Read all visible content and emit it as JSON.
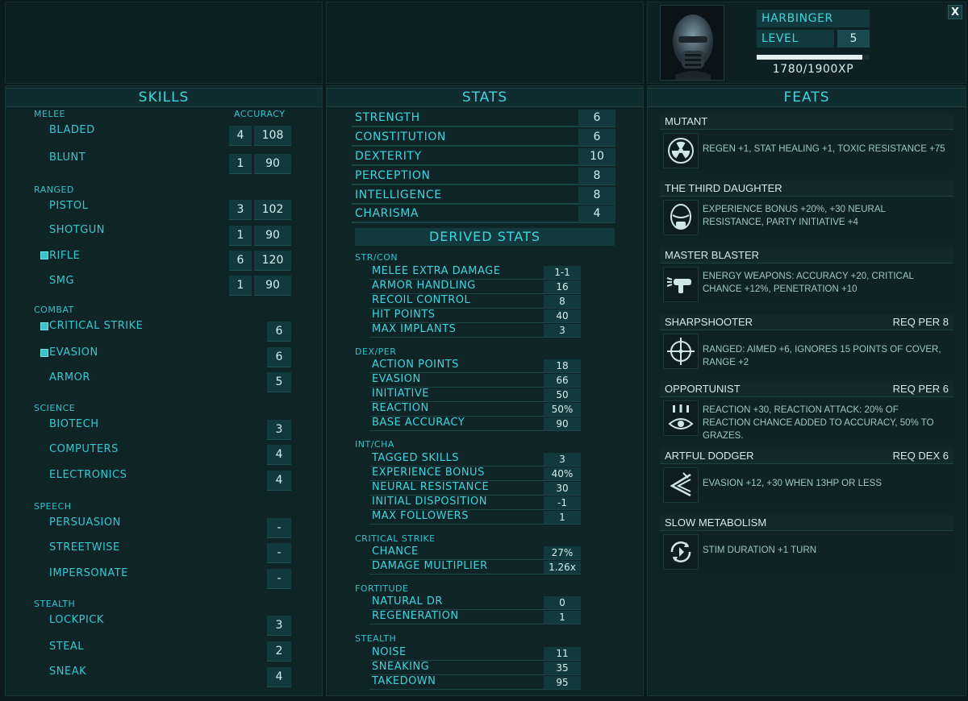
{
  "character": {
    "name": "HARBINGER",
    "level_label": "LEVEL",
    "level": "5",
    "xp_text": "1780/1900XP",
    "xp_progress": 0.937
  },
  "close_label": "X",
  "skills": {
    "title": "SKILLS",
    "accuracy_label": "ACCURACY",
    "categories": [
      {
        "name": "MELEE",
        "items": [
          {
            "name": "BLADED",
            "value": "4",
            "accuracy": "108",
            "tagged": false
          },
          {
            "name": "BLUNT",
            "value": "1",
            "accuracy": "90",
            "tagged": false
          }
        ]
      },
      {
        "name": "RANGED",
        "items": [
          {
            "name": "PISTOL",
            "value": "3",
            "accuracy": "102",
            "tagged": false
          },
          {
            "name": "SHOTGUN",
            "value": "1",
            "accuracy": "90",
            "tagged": false
          },
          {
            "name": "RIFLE",
            "value": "6",
            "accuracy": "120",
            "tagged": true
          },
          {
            "name": "SMG",
            "value": "1",
            "accuracy": "90",
            "tagged": false
          }
        ]
      },
      {
        "name": "COMBAT",
        "items": [
          {
            "name": "CRITICAL STRIKE",
            "value": "6",
            "tagged": true
          },
          {
            "name": "EVASION",
            "value": "6",
            "tagged": true
          },
          {
            "name": "ARMOR",
            "value": "5",
            "tagged": false
          }
        ]
      },
      {
        "name": "SCIENCE",
        "items": [
          {
            "name": "BIOTECH",
            "value": "3",
            "tagged": false
          },
          {
            "name": "COMPUTERS",
            "value": "4",
            "tagged": false
          },
          {
            "name": "ELECTRONICS",
            "value": "4",
            "tagged": false
          }
        ]
      },
      {
        "name": "SPEECH",
        "items": [
          {
            "name": "PERSUASION",
            "value": "-",
            "tagged": false
          },
          {
            "name": "STREETWISE",
            "value": "-",
            "tagged": false
          },
          {
            "name": "IMPERSONATE",
            "value": "-",
            "tagged": false
          }
        ]
      },
      {
        "name": "STEALTH",
        "items": [
          {
            "name": "LOCKPICK",
            "value": "3",
            "tagged": false
          },
          {
            "name": "STEAL",
            "value": "2",
            "tagged": false
          },
          {
            "name": "SNEAK",
            "value": "4",
            "tagged": false
          }
        ]
      }
    ]
  },
  "stats": {
    "title": "STATS",
    "primary": [
      {
        "name": "STRENGTH",
        "value": "6"
      },
      {
        "name": "CONSTITUTION",
        "value": "6"
      },
      {
        "name": "DEXTERITY",
        "value": "10"
      },
      {
        "name": "PERCEPTION",
        "value": "8"
      },
      {
        "name": "INTELLIGENCE",
        "value": "8"
      },
      {
        "name": "CHARISMA",
        "value": "4"
      }
    ],
    "derived_title": "DERIVED STATS",
    "derived_groups": [
      {
        "name": "STR/CON",
        "items": [
          {
            "name": "MELEE EXTRA DAMAGE",
            "value": "1-1"
          },
          {
            "name": "ARMOR HANDLING",
            "value": "16"
          },
          {
            "name": "RECOIL CONTROL",
            "value": "8"
          },
          {
            "name": "HIT POINTS",
            "value": "40"
          },
          {
            "name": "MAX IMPLANTS",
            "value": "3"
          }
        ]
      },
      {
        "name": "DEX/PER",
        "items": [
          {
            "name": "ACTION POINTS",
            "value": "18"
          },
          {
            "name": "EVASION",
            "value": "66"
          },
          {
            "name": "INITIATIVE",
            "value": "50"
          },
          {
            "name": "REACTION",
            "value": "50%"
          },
          {
            "name": "BASE ACCURACY",
            "value": "90"
          }
        ]
      },
      {
        "name": "INT/CHA",
        "items": [
          {
            "name": "TAGGED SKILLS",
            "value": "3"
          },
          {
            "name": "EXPERIENCE BONUS",
            "value": "40%"
          },
          {
            "name": "NEURAL RESISTANCE",
            "value": "30"
          },
          {
            "name": "INITIAL DISPOSITION",
            "value": "-1"
          },
          {
            "name": "MAX FOLLOWERS",
            "value": "1"
          }
        ]
      },
      {
        "name": "CRITICAL STRIKE",
        "items": [
          {
            "name": "CHANCE",
            "value": "27%"
          },
          {
            "name": "DAMAGE MULTIPLIER",
            "value": "1.26x"
          }
        ]
      },
      {
        "name": "FORTITUDE",
        "items": [
          {
            "name": "NATURAL DR",
            "value": "0"
          },
          {
            "name": "REGENERATION",
            "value": "1"
          }
        ]
      },
      {
        "name": "STEALTH",
        "items": [
          {
            "name": "NOISE",
            "value": "11"
          },
          {
            "name": "SNEAKING",
            "value": "35"
          },
          {
            "name": "TAKEDOWN",
            "value": "95"
          }
        ]
      }
    ]
  },
  "feats": {
    "title": "FEATS",
    "items": [
      {
        "name": "MUTANT",
        "req": "",
        "icon": "radiation-icon",
        "desc": "REGEN +1, STAT HEALING +1, TOXIC RESISTANCE +75"
      },
      {
        "name": "THE THIRD DAUGHTER",
        "req": "",
        "icon": "helmet-icon",
        "desc": "EXPERIENCE BONUS +20%, +30 NEURAL RESISTANCE, PARTY INITIATIVE +4"
      },
      {
        "name": "MASTER BLASTER",
        "req": "",
        "icon": "blaster-icon",
        "desc": "ENERGY WEAPONS: ACCURACY +20, CRITICAL CHANCE +12%, PENETRATION +10"
      },
      {
        "name": "SHARPSHOOTER",
        "req": "REQ PER 8",
        "icon": "crosshair-icon",
        "desc": "RANGED: AIMED +6, IGNORES 15 POINTS OF COVER, RANGE +2"
      },
      {
        "name": "OPPORTUNIST",
        "req": "REQ PER 6",
        "icon": "eye-icon",
        "desc": "REACTION +30, REACTION ATTACK: 20% OF REACTION CHANCE ADDED TO ACCURACY, 50% TO GRAZES."
      },
      {
        "name": "ARTFUL DODGER",
        "req": "REQ DEX 6",
        "icon": "dodge-icon",
        "desc": "EVASION +12, +30 WHEN 13HP OR LESS"
      },
      {
        "name": "SLOW METABOLISM",
        "req": "",
        "icon": "cycle-icon",
        "desc": "STIM DURATION +1 TURN"
      }
    ]
  }
}
